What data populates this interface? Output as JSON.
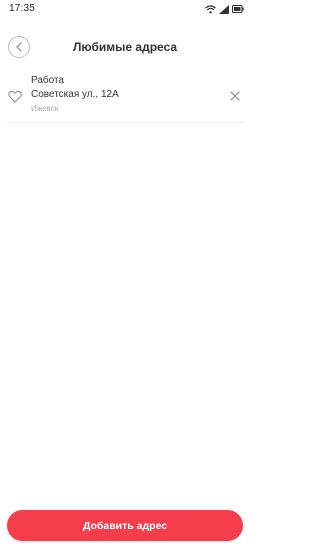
{
  "status_bar": {
    "time": "17:35",
    "icons": [
      "wifi-icon",
      "signal-icon",
      "battery-icon"
    ]
  },
  "header": {
    "back_icon": "chevron-left-icon",
    "title": "Любимые адреса"
  },
  "addresses": [
    {
      "name": "Работа",
      "street": "Советская ул., 12А",
      "city": "Ижевск",
      "favorite_icon": "heart-outline-icon",
      "delete_icon": "close-icon"
    }
  ],
  "footer": {
    "add_button_label": "Добавить адрес"
  },
  "colors": {
    "accent": "#f53d4b",
    "text": "#333333",
    "muted": "#aaaaaa"
  }
}
